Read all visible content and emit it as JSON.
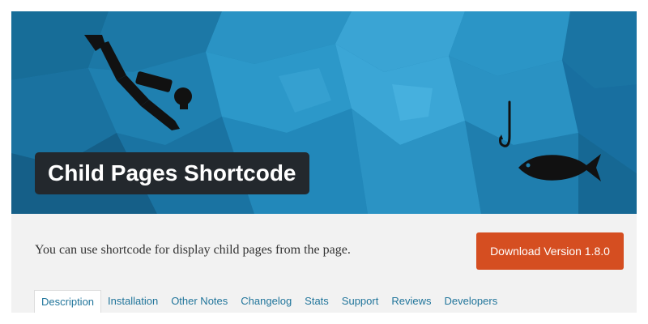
{
  "plugin": {
    "title": "Child Pages Shortcode",
    "description": "You can use shortcode for display child pages from the page.",
    "download_label": "Download Version 1.8.0"
  },
  "tabs": [
    {
      "label": "Description",
      "active": true
    },
    {
      "label": "Installation",
      "active": false
    },
    {
      "label": "Other Notes",
      "active": false
    },
    {
      "label": "Changelog",
      "active": false
    },
    {
      "label": "Stats",
      "active": false
    },
    {
      "label": "Support",
      "active": false
    },
    {
      "label": "Reviews",
      "active": false
    },
    {
      "label": "Developers",
      "active": false
    }
  ],
  "colors": {
    "banner": "#1f7fae",
    "title_bg": "#23282d",
    "download_button": "#d54e21",
    "tab_link": "#21759b",
    "info_bg": "#f2f2f2"
  },
  "icons": [
    "scuba-diver-icon",
    "fishing-hook-icon",
    "fish-icon"
  ]
}
